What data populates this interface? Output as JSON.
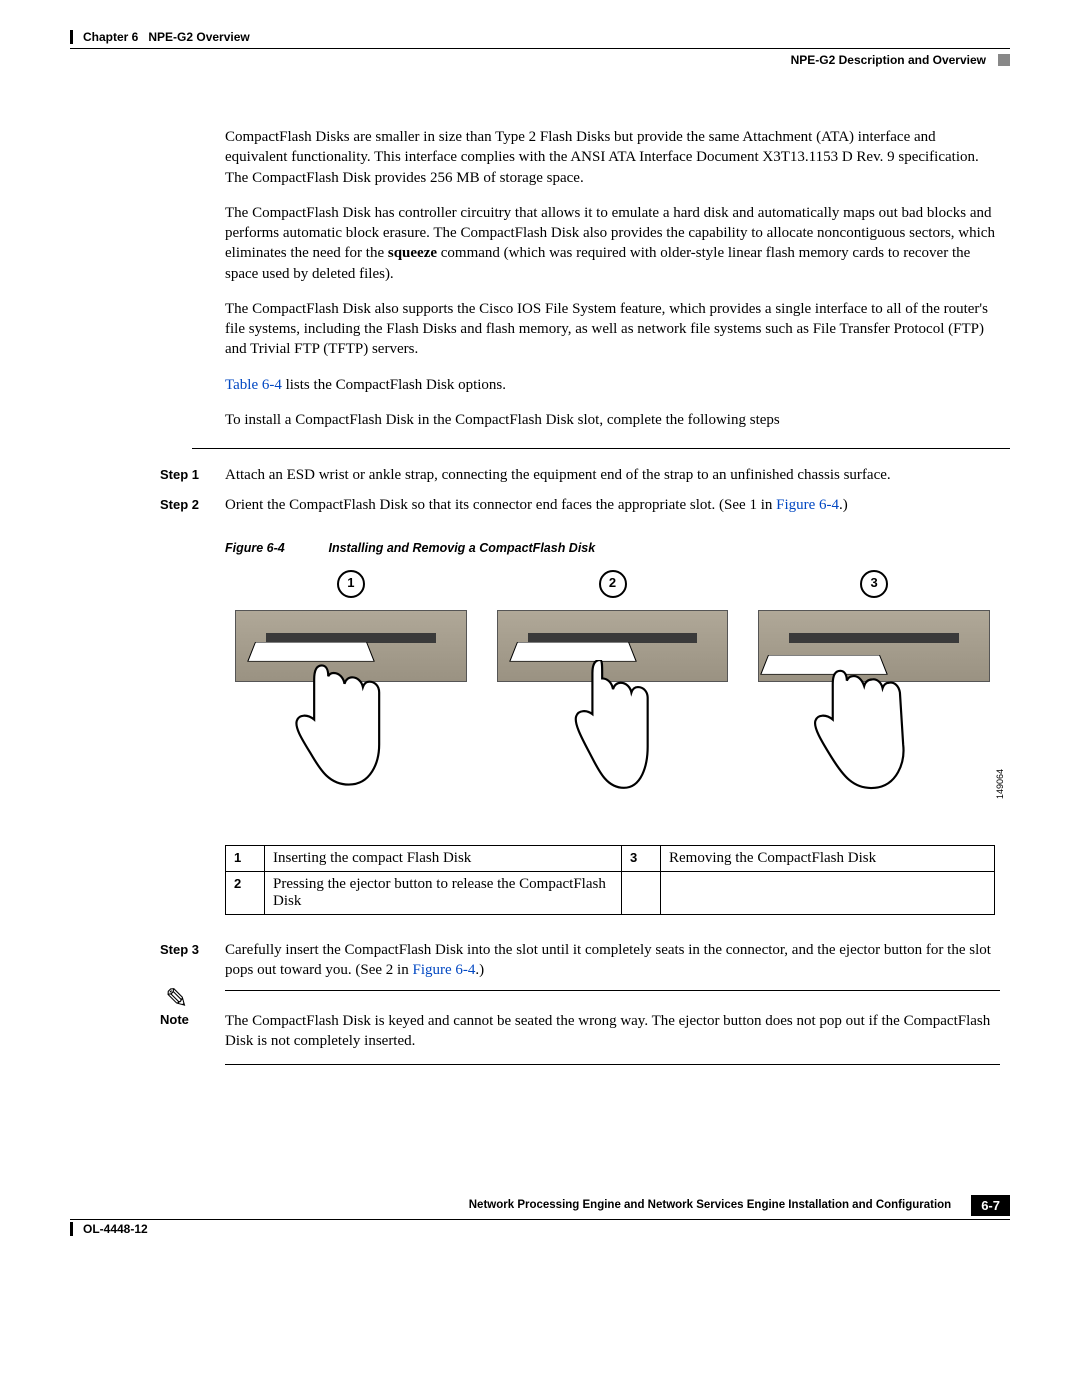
{
  "header": {
    "chapter": "Chapter 6",
    "title": "NPE-G2 Overview",
    "section": "NPE-G2 Description and Overview"
  },
  "body": {
    "p1": "CompactFlash Disks are smaller in size than Type 2 Flash Disks but provide the same Attachment (ATA) interface and equivalent functionality. This interface complies with the ANSI ATA Interface Document X3T13.1153 D Rev. 9 specification. The CompactFlash Disk provides 256 MB of storage space.",
    "p2_a": "The CompactFlash Disk has controller circuitry that allows it to emulate a hard disk and automatically maps out bad blocks and performs automatic block erasure. The CompactFlash Disk also provides the capability to allocate noncontiguous sectors, which eliminates the need for the ",
    "p2_bold": "squeeze",
    "p2_b": " command (which was required with older-style linear flash memory cards to recover the space used by deleted files).",
    "p3": "The CompactFlash Disk also supports the Cisco IOS File System feature, which provides a single interface to all of the router's file systems, including the Flash Disks and flash memory, as well as network file systems such as File Transfer Protocol (FTP) and Trivial FTP (TFTP) servers.",
    "p4_link": "Table 6-4",
    "p4_rest": " lists the CompactFlash Disk options.",
    "p5": "To install a CompactFlash Disk in the CompactFlash Disk slot, complete the following steps"
  },
  "steps": {
    "s1_label": "Step 1",
    "s1_text": "Attach an ESD wrist or ankle strap, connecting the equipment end of the strap to an unfinished chassis surface.",
    "s2_label": "Step 2",
    "s2_text_a": "Orient the CompactFlash Disk so that its connector end faces the appropriate slot. (See 1 in ",
    "s2_link": "Figure 6-4",
    "s2_text_b": ".)",
    "s3_label": "Step 3",
    "s3_text_a": "Carefully insert the CompactFlash Disk into the slot until it completely seats in the connector, and the ejector button for the slot pops out toward you. (See 2 in ",
    "s3_link": "Figure 6-4",
    "s3_text_b": ".)"
  },
  "figure": {
    "label": "Figure 6-4",
    "title": "Installing and Removig a CompactFlash Disk",
    "c1": "1",
    "c2": "2",
    "c3": "3",
    "imgnum": "149064"
  },
  "legend": {
    "n1": "1",
    "t1": "Inserting the compact Flash Disk",
    "n2": "2",
    "t2": "Pressing the ejector button to release the CompactFlash Disk",
    "n3": "3",
    "t3": "Removing the CompactFlash Disk"
  },
  "note": {
    "label": "Note",
    "text": "The CompactFlash Disk is keyed and cannot be seated the wrong way. The ejector button does not pop out if the CompactFlash Disk is not completely inserted."
  },
  "footer": {
    "book": "Network Processing Engine and Network Services Engine Installation and Configuration",
    "doc": "OL-4448-12",
    "page": "6-7"
  }
}
